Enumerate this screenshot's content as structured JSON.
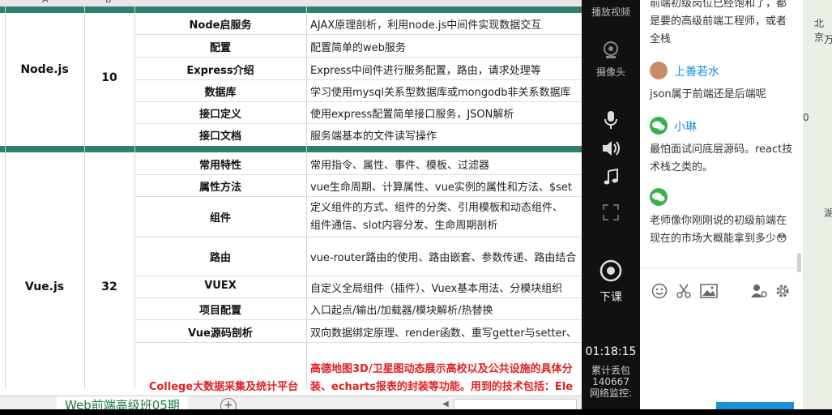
{
  "spreadsheet": {
    "column_headers": [
      "A",
      "B"
    ],
    "sections": [
      {
        "module": "Node.js",
        "hours": "10",
        "rows": [
          {
            "topic": "Node启服务",
            "desc": "AJAX原理剖析，利用node.js中间件实现数据交互"
          },
          {
            "topic": "配置",
            "desc": "配置简单的web服务"
          },
          {
            "topic": "Express介绍",
            "desc": "Express中间件进行服务配置，路由，请求处理等"
          },
          {
            "topic": "数据库",
            "desc": "学习使用mysql关系型数据库或mongodb非关系数据库"
          },
          {
            "topic": "接口定义",
            "desc": "使用express配置简单接口服务，JSON解析"
          },
          {
            "topic": "接口文档",
            "desc": "服务端基本的文件读写操作"
          }
        ]
      },
      {
        "module": "Vue.js",
        "hours": "32",
        "rows": [
          {
            "topic": "常用特性",
            "desc": "常用指令、属性、事件、模板、过滤器"
          },
          {
            "topic": "属性方法",
            "desc": "vue生命周期、计算属性、vue实例的属性和方法、$set"
          },
          {
            "topic": "组件",
            "desc": "定义组件的方式、组件的分类、引用模板和动态组件、组件通信、slot内容分发、生命周期剖析"
          },
          {
            "topic": "路由",
            "desc": "vue-router路由的使用、路由嵌套、参数传递、路由结合"
          },
          {
            "topic": "VUEX",
            "desc": "自定义全局组件（插件）、Vuex基本用法、分模块组织"
          },
          {
            "topic": "项目配置",
            "desc": "入口起点/输出/加载器/模块解析/热替换"
          },
          {
            "topic": "Vue源码剖析",
            "desc": "双向数据绑定原理、render函数、重写getter与setter、"
          }
        ]
      }
    ],
    "project": {
      "name": "College大数据采集及统计平台",
      "desc": "高德地图3D/卫星图动态展示高校以及公共设施的具体分装、echarts报表的封装等功能。用到的技术包括：Ele"
    },
    "sheet_tab": "Web前端高级班05期",
    "add_sheet": "+"
  },
  "video_panel": {
    "top_label": "播放视频",
    "camera_label": "摄像头",
    "leave_label": "下课",
    "elapsed": "01:18:15",
    "packet_loss_label": "累计丢包",
    "packet_loss_value": "140667",
    "network_label": "网络监控:"
  },
  "chat": {
    "top_message": "前端初级岗位已经饱和了，都是要的高级前端工程师，或者全栈",
    "messages": [
      {
        "user": "上善若水",
        "text": "json属于前端还是后端呢"
      },
      {
        "user": "小琳",
        "text": "最怕面试问底层源码。react技术栈之类的。"
      },
      {
        "user": "",
        "text": "老师像你刚刚说的初级前端在现在的市场大概能拿到多少"
      }
    ],
    "emoji": "😳",
    "toolbar": [
      "emoji-icon",
      "scissors-icon",
      "image-icon",
      "user-settings-icon",
      "gear-icon"
    ]
  },
  "map": {
    "labels": [
      "北京",
      "万",
      "0",
      "湖"
    ]
  }
}
